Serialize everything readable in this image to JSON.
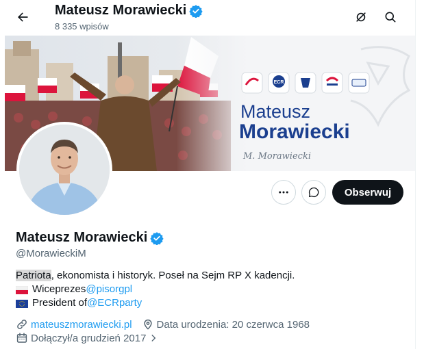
{
  "header": {
    "name": "Mateusz Morawiecki",
    "posts_count": "8 335 wpisów"
  },
  "banner": {
    "title_line1": "Mateusz",
    "title_line2": "Morawiecki",
    "logos": [
      "ECR"
    ],
    "signature": "M. Morawiecki"
  },
  "actions": {
    "follow_label": "Obserwuj"
  },
  "profile": {
    "display_name": "Mateusz Morawiecki",
    "handle": "@MorawieckiM",
    "bio": {
      "line1_highlight": "Patriota",
      "line1_rest": ", ekonomista i historyk. Poseł na Sejm RP X kadencji.",
      "line2_text": "Wiceprezes ",
      "line2_link": "@pisorgpl",
      "line3_text": "President of ",
      "line3_link": "@ECRparty"
    },
    "website": "mateuszmorawiecki.pl",
    "birthdate": "Data urodzenia: 20 czerwca 1968",
    "joined": "Dołączył/a grudzień 2017"
  },
  "colors": {
    "accent": "#1d9bf0",
    "text": "#0f1419",
    "secondary": "#536471",
    "follow_bg": "#0f1419",
    "verified": "#1d9bf0"
  },
  "icons": [
    "back-arrow-icon",
    "grok-icon",
    "search-icon",
    "more-icon",
    "message-icon",
    "verified-badge-icon",
    "link-icon",
    "location-pin-icon",
    "calendar-icon",
    "chevron-right-icon"
  ]
}
